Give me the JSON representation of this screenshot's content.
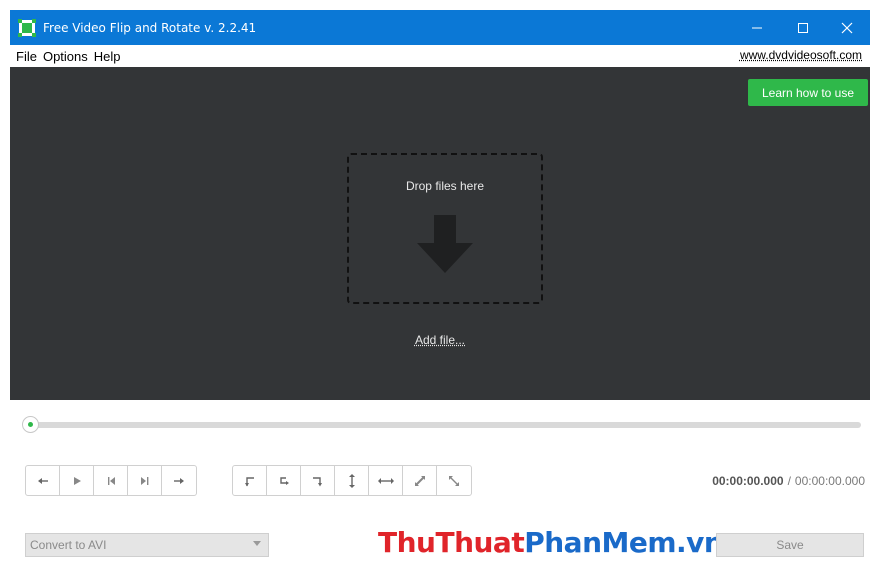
{
  "window": {
    "title": "Free Video Flip and Rotate v. 2.2.41",
    "controls": {
      "minimize": "─",
      "maximize": "☐",
      "close": "✕"
    }
  },
  "menu": {
    "items": [
      "File",
      "Options",
      "Help"
    ],
    "site_link": "www.dvdvideosoft.com"
  },
  "stage": {
    "learn_button": "Learn how to use",
    "drop_text": "Drop files here",
    "add_file": "Add file..."
  },
  "seek": {
    "position": 0
  },
  "playback_buttons": [
    "step-back-icon",
    "play-icon",
    "skip-to-start-icon",
    "skip-to-end-icon",
    "step-forward-icon"
  ],
  "transform_buttons": [
    "rotate-left-icon",
    "rotate-right-icon",
    "rotate-180-icon",
    "flip-vertical-icon",
    "flip-horizontal-icon",
    "transpose-icon",
    "transverse-icon"
  ],
  "time": {
    "current": "00:00:00.000",
    "separator": "/",
    "total": "00:00:00.000"
  },
  "output": {
    "format_value": "Convert to AVI",
    "save_label": "Save"
  },
  "watermark": {
    "part1": "ThuThuat",
    "part2": "PhanMem",
    "part3": ".vn"
  },
  "colors": {
    "titlebar": "#0b78d6",
    "stage_bg": "#333537",
    "accent_green": "#2fb84a",
    "watermark_red": "#e0242a",
    "watermark_blue": "#1a6ac9"
  }
}
